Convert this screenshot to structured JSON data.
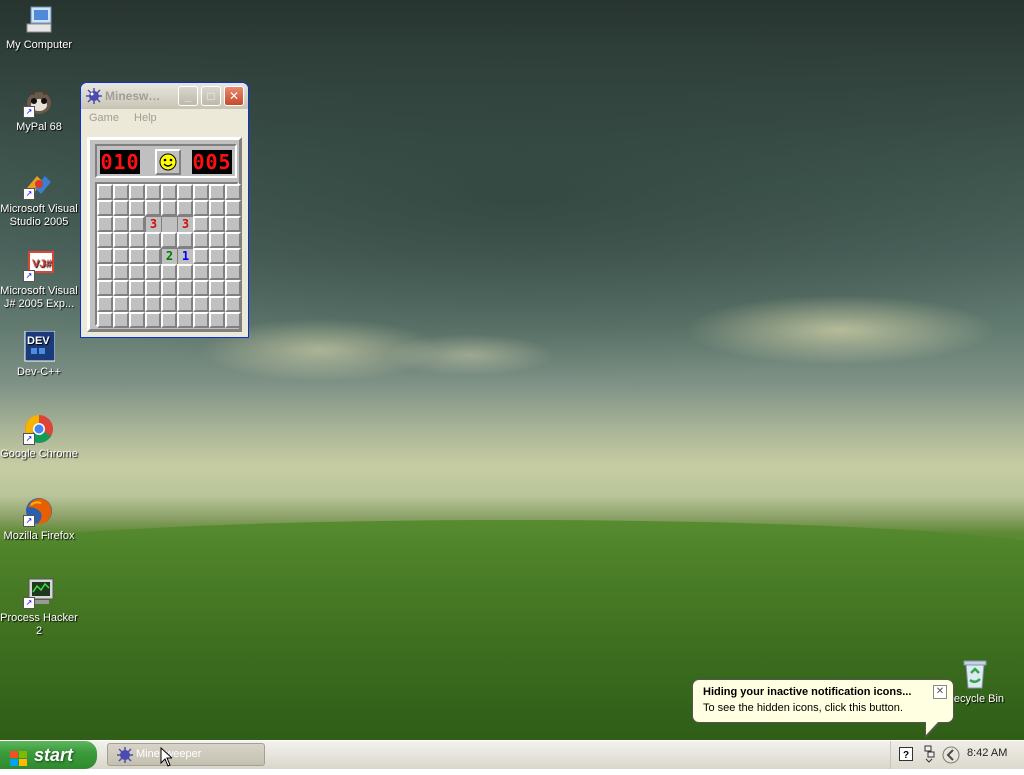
{
  "desktop": {
    "icons": [
      {
        "label": "My Computer",
        "icon": "my-computer-icon"
      },
      {
        "label": "MyPal 68",
        "icon": "mypal-icon"
      },
      {
        "label": "Microsoft Visual Studio 2005",
        "icon": "visual-studio-icon"
      },
      {
        "label": "Microsoft Visual J# 2005 Exp...",
        "icon": "visual-jsharp-icon"
      },
      {
        "label": "Dev-C++",
        "icon": "dev-cpp-icon"
      },
      {
        "label": "Google Chrome",
        "icon": "chrome-icon"
      },
      {
        "label": "Mozilla Firefox",
        "icon": "firefox-icon"
      },
      {
        "label": "Process Hacker 2",
        "icon": "process-hacker-icon"
      },
      {
        "label": "Recycle Bin",
        "icon": "recycle-bin-icon"
      }
    ]
  },
  "minesweeper": {
    "title": "Minesweeper",
    "title_display": "Minesw…",
    "menu": [
      "Game",
      "Help"
    ],
    "mine_counter": "010",
    "timer": "005",
    "grid_size": 9,
    "revealed": [
      {
        "r": 2,
        "c": 3,
        "v": "3",
        "color": "#d01010"
      },
      {
        "r": 2,
        "c": 4,
        "v": "",
        "color": "#000000"
      },
      {
        "r": 2,
        "c": 5,
        "v": "3",
        "color": "#d01010"
      },
      {
        "r": 4,
        "c": 4,
        "v": "2",
        "color": "#007b00"
      },
      {
        "r": 4,
        "c": 5,
        "v": "1",
        "color": "#0000ff"
      }
    ]
  },
  "taskbar": {
    "start_label": "start",
    "task_label": "Minesweeper",
    "clock": "8:42 AM"
  },
  "balloon": {
    "title": "Hiding your inactive notification icons...",
    "text": "To see the hidden icons, click this button."
  },
  "colors": {
    "start_green": "#3c9c3c",
    "led_red": "#ff1010",
    "window_border": "#0831d9",
    "balloon_bg": "#ffffe1"
  }
}
